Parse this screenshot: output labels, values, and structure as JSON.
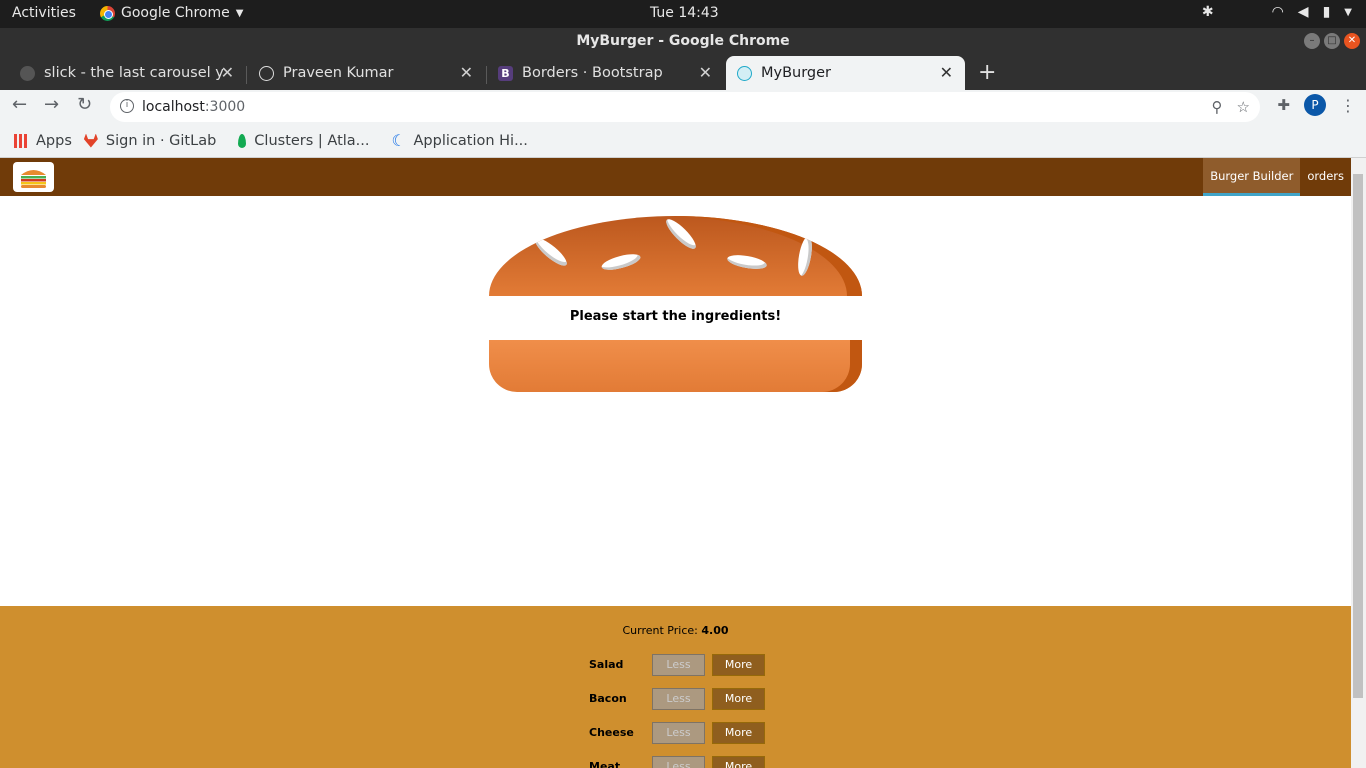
{
  "os": {
    "activities": "Activities",
    "app_name": "Google Chrome",
    "clock": "Tue 14:43"
  },
  "window": {
    "title": "MyBurger - Google Chrome"
  },
  "tabs": [
    {
      "title": "slick - the last carousel you"
    },
    {
      "title": "Praveen Kumar"
    },
    {
      "title": "Borders · Bootstrap"
    },
    {
      "title": "MyBurger"
    }
  ],
  "omnibox": {
    "host": "localhost",
    "port": ":3000"
  },
  "profile": {
    "initial": "P"
  },
  "bookmarks": [
    {
      "label": "Apps"
    },
    {
      "label": "Sign in · GitLab"
    },
    {
      "label": "Clusters | Atla..."
    },
    {
      "label": "Application Hi..."
    }
  ],
  "app": {
    "nav": {
      "burger_builder": "Burger Builder",
      "orders": "orders"
    },
    "message": "Please start the ingredients!",
    "price_label": "Current Price:",
    "price_value": "4.00",
    "controls": [
      {
        "label": "Salad",
        "less": "Less",
        "more": "More"
      },
      {
        "label": "Bacon",
        "less": "Less",
        "more": "More"
      },
      {
        "label": "Cheese",
        "less": "Less",
        "more": "More"
      },
      {
        "label": "Meat",
        "less": "Less",
        "more": "More"
      }
    ]
  },
  "colors": {
    "navbar": "#703b09",
    "controls_bg": "#cf8f2e",
    "bread": "#e27b36"
  }
}
